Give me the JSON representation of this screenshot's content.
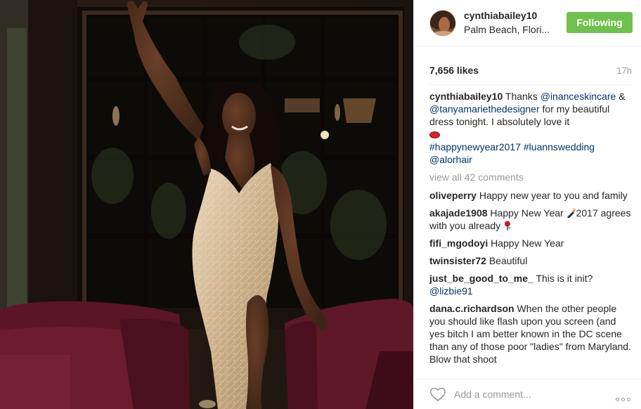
{
  "post": {
    "username": "cynthiabailey10",
    "location": "Palm Beach, Flori...",
    "follow_label": "Following",
    "likes": "7,656 likes",
    "age": "17h",
    "view_all": "view all 42 comments",
    "add_comment_placeholder": "Add a comment...",
    "caption": {
      "user": "cynthiabailey10",
      "text_1": "Thanks",
      "mention_1": "@inanceskincare",
      "text_2": "&",
      "mention_2": "@tanyamariethedesigner",
      "text_3": "for my beautiful dress tonight. I absolutely love it",
      "emoji": "lips",
      "hashtag_1": "#happynewyear2017",
      "hashtag_2": "#luannswedding",
      "mention_3": "@alorhair"
    }
  },
  "comments": [
    {
      "user": "oliveperry",
      "text": "Happy new year to you and family"
    },
    {
      "user": "akajade1908",
      "text_a": "Happy New Year",
      "emoji_a": "champagne-bottle",
      "text_b": "2017 agrees with you already",
      "emoji_b": "rose"
    },
    {
      "user": "fifi_mgodoyi",
      "text": "Happy New Year"
    },
    {
      "user": "twinsister72",
      "text": "Beautiful"
    },
    {
      "user": "just_be_good_to_me_",
      "text": "This is it init?",
      "mention": "@lizbie91"
    },
    {
      "user": "dana.c.richardson",
      "text": "When the other people you should like flash upon you screen (and yes bitch I am better known in the DC scene than any of those poor \"ladies\" from Maryland. Blow that shoot"
    }
  ],
  "colors": {
    "follow_bg": "#70c050",
    "link": "#003569",
    "muted": "#999999",
    "text": "#262626"
  },
  "icons": [
    "heart-icon",
    "more-options-icon"
  ]
}
